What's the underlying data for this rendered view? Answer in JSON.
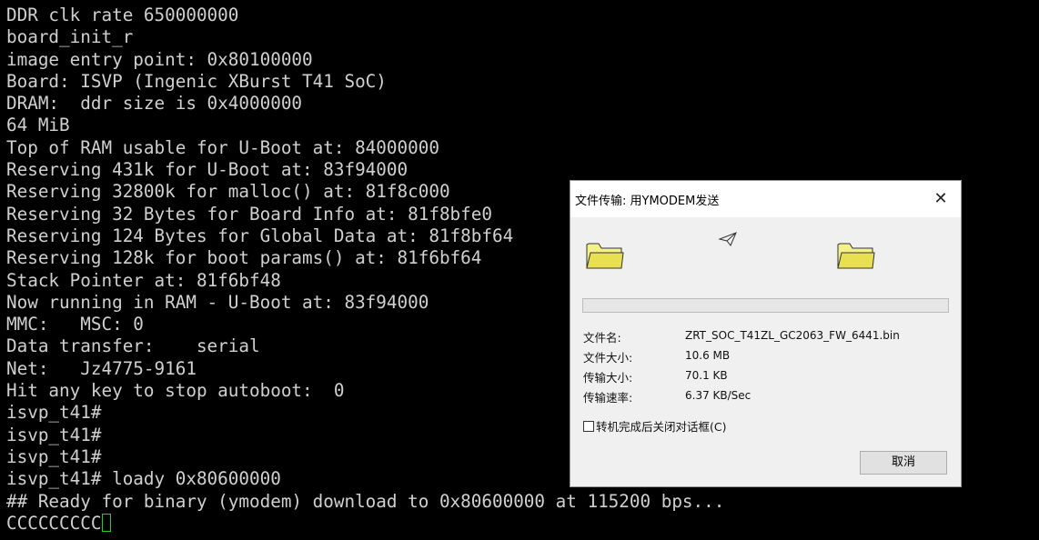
{
  "terminal": {
    "lines": [
      "DDR clk rate 650000000",
      "board_init_r",
      "image entry point: 0x80100000",
      "Board: ISVP (Ingenic XBurst T41 SoC)",
      "DRAM:  ddr size is 0x4000000",
      "64 MiB",
      "Top of RAM usable for U-Boot at: 84000000",
      "Reserving 431k for U-Boot at: 83f94000",
      "Reserving 32800k for malloc() at: 81f8c000",
      "Reserving 32 Bytes for Board Info at: 81f8bfe0",
      "Reserving 124 Bytes for Global Data at: 81f8bf64",
      "Reserving 128k for boot params() at: 81f6bf64",
      "Stack Pointer at: 81f6bf48",
      "Now running in RAM - U-Boot at: 83f94000",
      "MMC:   MSC: 0",
      "Data transfer:    serial",
      "Net:   Jz4775-9161",
      "Hit any key to stop autoboot:  0",
      "isvp_t41#",
      "isvp_t41#",
      "isvp_t41#",
      "isvp_t41# loady 0x80600000",
      "## Ready for binary (ymodem) download to 0x80600000 at 115200 bps...",
      "CCCCCCCCC"
    ],
    "text_color": "#d0d0d0",
    "cursor_color": "#20d020"
  },
  "dialog": {
    "title": "文件传输: 用YMODEM发送",
    "close_icon": "close-icon",
    "source_icon": "folder-icon",
    "dest_icon": "folder-icon",
    "transfer_icon": "paper-airplane-icon",
    "progress": 0.0,
    "filename_label": "文件名:",
    "filename_value": "ZRT_SOC_T41ZL_GC2063_FW_6441.bin",
    "filesize_label": "文件大小:",
    "filesize_value": "10.6 MB",
    "transferred_label": "传输大小:",
    "transferred_value": "70.1 KB",
    "rate_label": "传输速率:",
    "rate_value": "6.37 KB/Sec",
    "checkbox_label": "转机完成后关闭对话框(C)",
    "checkbox_checked": false,
    "cancel_label": "取消"
  }
}
